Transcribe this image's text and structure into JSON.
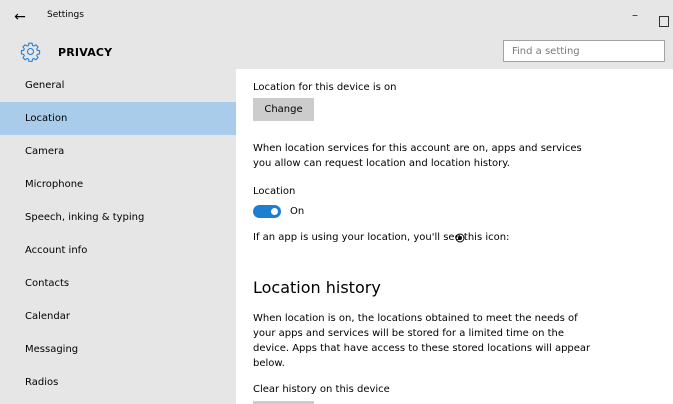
{
  "window": {
    "back_glyph": "←",
    "title": "Settings",
    "minimize_glyph": "–"
  },
  "header": {
    "icon": "gear-icon",
    "title": "PRIVACY"
  },
  "search": {
    "placeholder": "Find a setting"
  },
  "sidebar": {
    "selected": "Location",
    "items": [
      {
        "label": "General"
      },
      {
        "label": "Location"
      },
      {
        "label": "Camera"
      },
      {
        "label": "Microphone"
      },
      {
        "label": "Speech, inking & typing"
      },
      {
        "label": "Account info"
      },
      {
        "label": "Contacts"
      },
      {
        "label": "Calendar"
      },
      {
        "label": "Messaging"
      },
      {
        "label": "Radios"
      }
    ]
  },
  "content": {
    "device_status": "Location for this device is on",
    "change_label": "Change",
    "services_desc_1": "When location services for this account are on, apps and services",
    "services_desc_2": "you allow can request location and location history.",
    "location_label": "Location",
    "toggle_state": "On",
    "icon_note": "If an app is using your location, you'll see this icon:",
    "history_heading": "Location history",
    "history_desc_1": "When location is on, the locations obtained to meet the needs of",
    "history_desc_2": "your apps and services will be stored for a limited time on the",
    "history_desc_3": "device. Apps that have access to these stored locations will appear",
    "history_desc_4": "below.",
    "clear_history_label": "Clear history on this device"
  },
  "colors": {
    "chrome_gray": "#e6e6e6",
    "selected_nav": "#a8cce9",
    "toggle_on": "#1e7ed1",
    "button_gray": "#cccccc"
  }
}
